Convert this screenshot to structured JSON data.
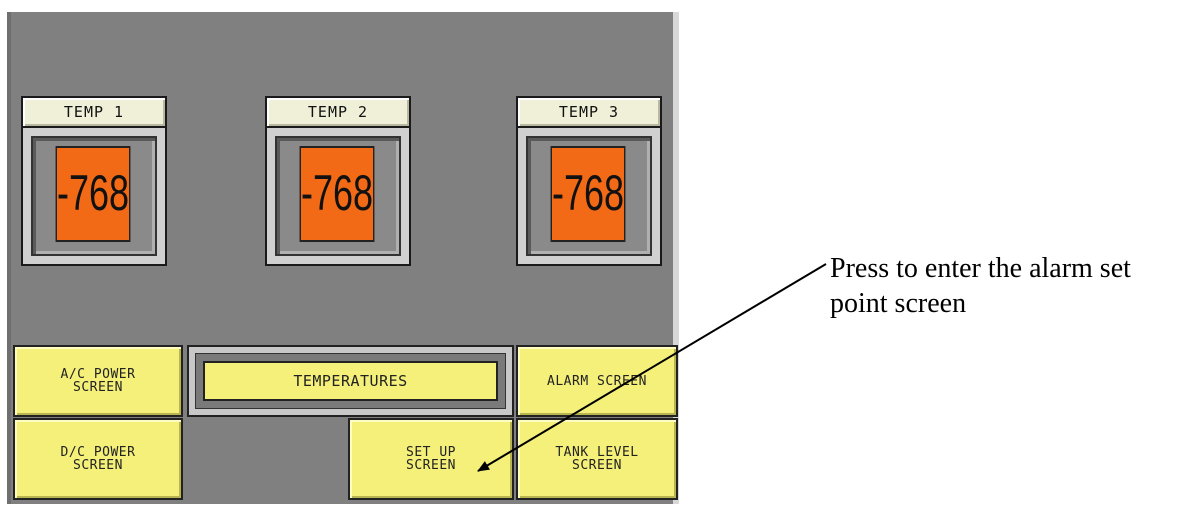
{
  "gauges": [
    {
      "label": "TEMP 1",
      "value": "-768"
    },
    {
      "label": "TEMP 2",
      "value": "-768"
    },
    {
      "label": "TEMP 3",
      "value": "-768"
    }
  ],
  "buttons": {
    "ac_power": "A/C POWER\nSCREEN",
    "dc_power": "D/C POWER\nSCREEN",
    "temperatures": "TEMPERATURES",
    "alarm": "ALARM SCREEN",
    "set_up": "SET UP\nSCREEN",
    "tank_level": "TANK LEVEL\nSCREEN"
  },
  "annotation": {
    "text": "Press to enter the alarm set point screen"
  },
  "colors": {
    "panel_bg": "#808080",
    "gauge_display": "#f26a16",
    "button_yellow": "#f4f07a"
  }
}
